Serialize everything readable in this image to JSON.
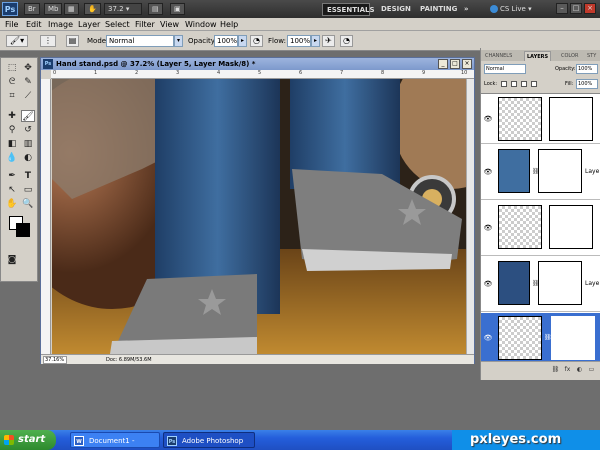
{
  "appbar": {
    "logo": "Ps",
    "zoom": "37.2",
    "workspaces": [
      "ESSENTIALS",
      "DESIGN",
      "PAINTING"
    ],
    "more": "»",
    "cs_live": "CS Live",
    "min": "–",
    "max": "□",
    "close": "×"
  },
  "menu": [
    "File",
    "Edit",
    "Image",
    "Layer",
    "Select",
    "Filter",
    "View",
    "Window",
    "Help"
  ],
  "options": {
    "mode_label": "Mode:",
    "mode_value": "Normal",
    "opacity_label": "Opacity:",
    "opacity_value": "100%",
    "flow_label": "Flow:",
    "flow_value": "100%"
  },
  "document": {
    "title": "Hand stand.psd @ 37.2% (Layer 5, Layer Mask/8) *",
    "zoom": "37.16%",
    "doc_size": "Doc: 6.89M/53.6M",
    "ruler_top": [
      "0",
      "1",
      "2",
      "3",
      "4",
      "5",
      "6",
      "7",
      "8",
      "9",
      "10"
    ]
  },
  "panels": {
    "tabs": [
      "CHANNELS",
      "LAYERS",
      "COLOR",
      "STY"
    ],
    "blend_mode": "Normal",
    "opacity_label": "Opacity:",
    "opacity_value": "100%",
    "lock_label": "Lock:",
    "fill_label": "Fill:",
    "fill_value": "100%",
    "layers": [
      {
        "name": "",
        "selected": false
      },
      {
        "name": "Laye",
        "selected": false
      },
      {
        "name": "",
        "selected": false
      },
      {
        "name": "Laye",
        "selected": false
      },
      {
        "name": "",
        "selected": true
      }
    ],
    "bottom_icons": [
      "fx",
      "◐",
      "▭",
      "◻",
      "🗑"
    ]
  },
  "taskbar": {
    "start": "start",
    "tasks": [
      {
        "label": "Document1 - Microsof...",
        "icon": "W"
      },
      {
        "label": "Adobe Photoshop CS5",
        "icon": "Ps"
      }
    ]
  },
  "watermark": "pxleyes.com",
  "colors": {
    "accent": "#3a6fd0",
    "title_blue": "#7d99cc",
    "taskbar": "#245edb"
  }
}
